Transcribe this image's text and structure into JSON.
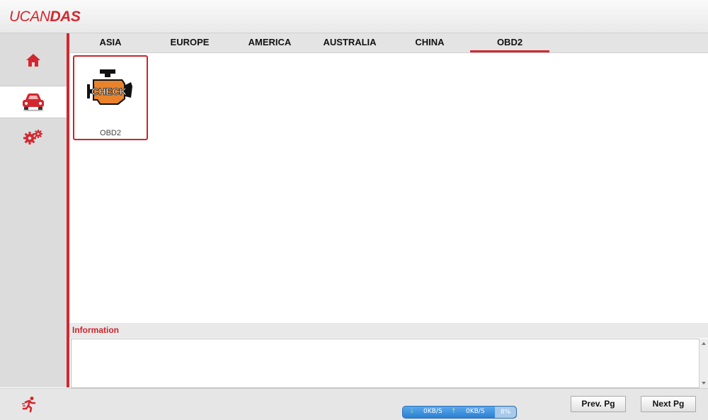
{
  "app": {
    "logo_light": "UCAN",
    "logo_bold": "DAS"
  },
  "sidebar": {
    "items": [
      {
        "icon": "home-icon",
        "active": false
      },
      {
        "icon": "car-icon",
        "active": true
      },
      {
        "icon": "gears-icon",
        "active": false
      }
    ]
  },
  "tabs": [
    {
      "label": "ASIA"
    },
    {
      "label": "EUROPE"
    },
    {
      "label": "AMERICA"
    },
    {
      "label": "AUSTRALIA"
    },
    {
      "label": "CHINA"
    },
    {
      "label": "OBD2",
      "active": true
    }
  ],
  "tiles": [
    {
      "label": "OBD2",
      "icon_text": "CHECK",
      "icon": "check-engine-icon"
    }
  ],
  "info": {
    "title": "Information",
    "text": ""
  },
  "status": {
    "download": "0KB/S",
    "upload": "0KB/S",
    "percent": "8%"
  },
  "buttons": {
    "prev": "Prev. Pg",
    "next": "Next Pg"
  },
  "colors": {
    "accent": "#d3272f",
    "engine_orange": "#e8832b"
  }
}
